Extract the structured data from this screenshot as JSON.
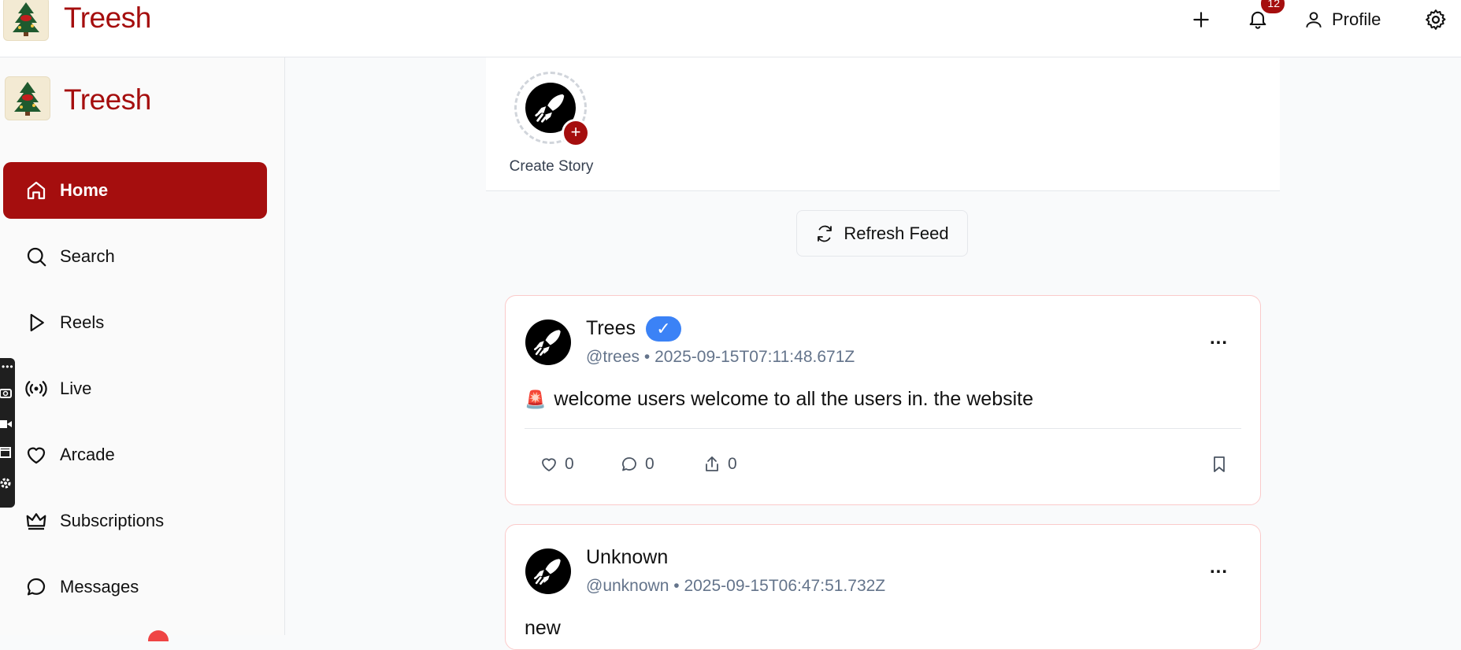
{
  "app": {
    "brand": "Treesh"
  },
  "topbar": {
    "notification_count": "12",
    "profile_label": "Profile",
    "icons": [
      "plus-icon",
      "bell-icon",
      "user-icon",
      "gear-icon"
    ]
  },
  "sidebar": {
    "items": [
      {
        "label": "Home",
        "icon": "home-icon",
        "active": true
      },
      {
        "label": "Search",
        "icon": "search-icon"
      },
      {
        "label": "Reels",
        "icon": "play-icon"
      },
      {
        "label": "Live",
        "icon": "broadcast-icon"
      },
      {
        "label": "Arcade",
        "icon": "heart-icon"
      },
      {
        "label": "Subscriptions",
        "icon": "crown-icon"
      },
      {
        "label": "Messages",
        "icon": "chat-icon"
      }
    ]
  },
  "stories": {
    "create_label": "Create Story"
  },
  "feed": {
    "refresh_label": "Refresh Feed",
    "posts": [
      {
        "author": "Trees",
        "verified": true,
        "verified_mark": "✓",
        "handle": "@trees",
        "separator": "•",
        "timestamp": "2025-09-15T07:11:48.671Z",
        "emoji": "🚨",
        "content": "welcome users welcome to all the users in. the website",
        "likes": "0",
        "comments": "0",
        "shares": "0",
        "more": "..."
      },
      {
        "author": "Unknown",
        "handle": "@unknown",
        "separator": "•",
        "timestamp": "2025-09-15T06:47:51.732Z",
        "content": "new",
        "more": "..."
      }
    ]
  },
  "colors": {
    "brand": "#a50e0e",
    "verified": "#3b82f6",
    "card_border": "#fbcaca"
  }
}
